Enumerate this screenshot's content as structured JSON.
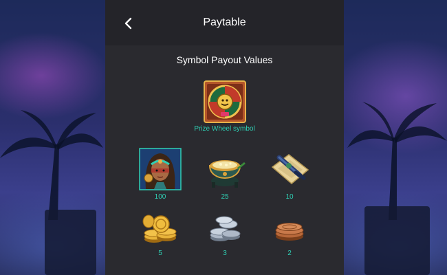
{
  "header": {
    "title": "Paytable",
    "back_icon": "chevron-left-icon"
  },
  "section": {
    "title": "Symbol Payout Values"
  },
  "prize_wheel": {
    "caption": "Prize Wheel symbol",
    "icon": "prize-wheel-icon"
  },
  "symbols": [
    {
      "icon": "explorer-woman-icon",
      "value": "100"
    },
    {
      "icon": "cauldron-pot-icon",
      "value": "25"
    },
    {
      "icon": "map-scroll-icon",
      "value": "10"
    },
    {
      "icon": "gold-coins-icon",
      "value": "5"
    },
    {
      "icon": "silver-coins-icon",
      "value": "3"
    },
    {
      "icon": "bronze-coins-icon",
      "value": "2"
    }
  ],
  "colors": {
    "panel": "#2a2a2f",
    "header": "#242429",
    "accent_teal": "#2fd0b4",
    "text": "#ffffff"
  }
}
